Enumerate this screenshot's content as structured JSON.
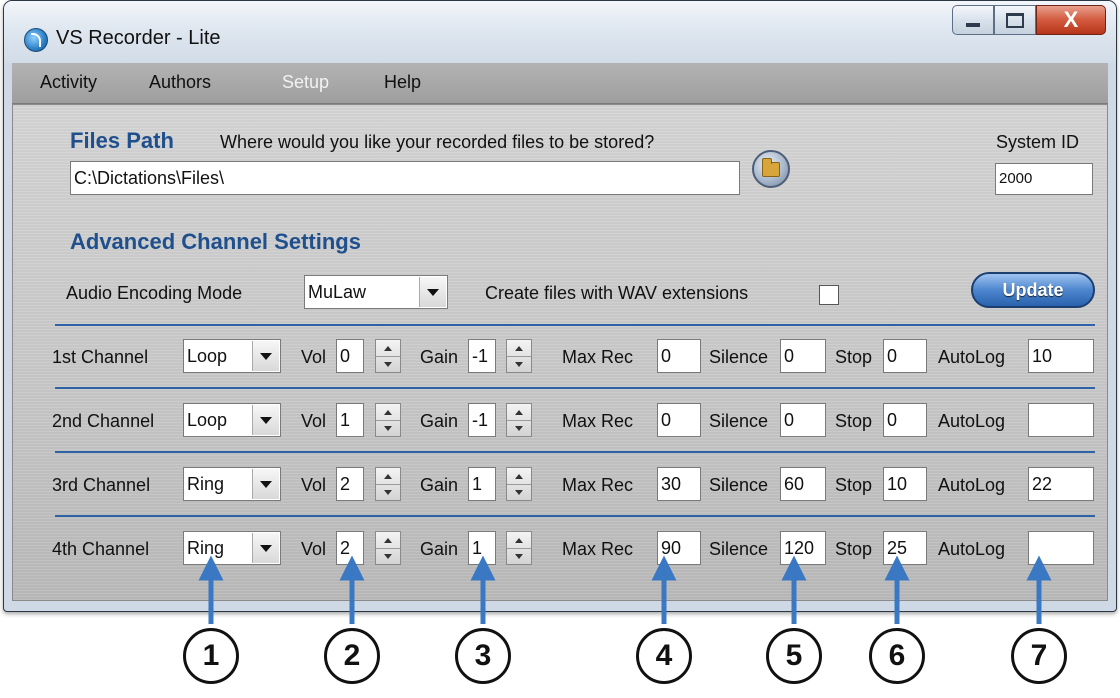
{
  "window": {
    "title": "VS Recorder - Lite",
    "close_glyph": "X"
  },
  "menu": [
    "Activity",
    "Authors",
    "Setup",
    "Help"
  ],
  "files_path": {
    "heading": "Files Path",
    "prompt": "Where would you like your recorded files to be stored?",
    "value": "C:\\Dictations\\Files\\",
    "system_id_label": "System ID",
    "system_id_value": "2000"
  },
  "advanced": {
    "heading": "Advanced Channel Settings",
    "encoding_label": "Audio Encoding Mode",
    "encoding_value": "MuLaw",
    "wav_label": "Create files with WAV extensions",
    "wav_checked": false,
    "update_label": "Update"
  },
  "field_labels": {
    "vol": "Vol",
    "gain": "Gain",
    "max_rec": "Max Rec",
    "silence": "Silence",
    "stop": "Stop",
    "autolog": "AutoLog"
  },
  "channels": [
    {
      "name": "1st Channel",
      "mode": "Loop",
      "vol": "0",
      "gain": "-1",
      "max_rec": "0",
      "silence": "0",
      "stop": "0",
      "autolog": "10"
    },
    {
      "name": "2nd Channel",
      "mode": "Loop",
      "vol": "1",
      "gain": "-1",
      "max_rec": "0",
      "silence": "0",
      "stop": "0",
      "autolog": ""
    },
    {
      "name": "3rd Channel",
      "mode": "Ring",
      "vol": "2",
      "gain": "1",
      "max_rec": "30",
      "silence": "60",
      "stop": "10",
      "autolog": "22"
    },
    {
      "name": "4th Channel",
      "mode": "Ring",
      "vol": "2",
      "gain": "1",
      "max_rec": "90",
      "silence": "120",
      "stop": "25",
      "autolog": ""
    }
  ],
  "callouts": [
    "1",
    "2",
    "3",
    "4",
    "5",
    "6",
    "7"
  ],
  "colors": {
    "heading_blue": "#1f4f8c",
    "separator_blue": "#2f61a6",
    "callout_arrow_blue": "#3a78c4"
  },
  "icons": [
    "app-logo-icon",
    "minimize-icon",
    "maximize-icon",
    "close-icon",
    "browse-folder-icon",
    "dropdown-arrow-icon",
    "spinner-arrows-icon"
  ]
}
